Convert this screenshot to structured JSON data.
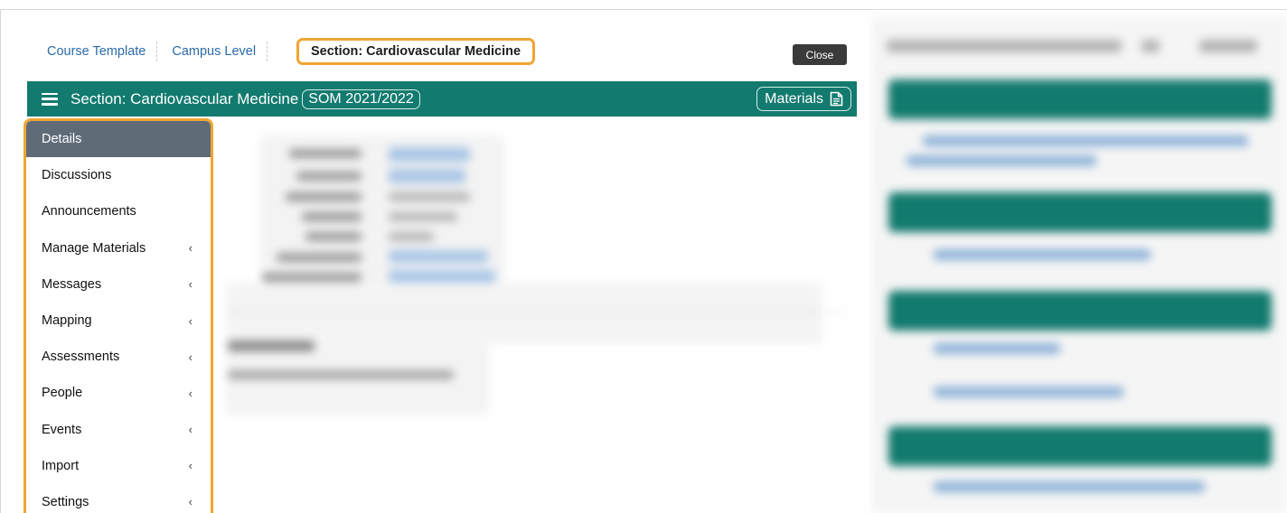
{
  "breadcrumb": {
    "items": [
      "Course Template",
      "Campus Level"
    ],
    "current": "Section: Cardiovascular Medicine"
  },
  "close_label": "Close",
  "section_bar": {
    "title": "Section: Cardiovascular Medicine",
    "term": "SOM 2021/2022",
    "materials_label": "Materials"
  },
  "nav": {
    "items": [
      {
        "label": "Details",
        "active": true,
        "has_submenu": false
      },
      {
        "label": "Discussions",
        "has_submenu": false
      },
      {
        "label": "Announcements",
        "has_submenu": false
      },
      {
        "label": "Manage Materials",
        "has_submenu": true
      },
      {
        "label": "Messages",
        "has_submenu": true
      },
      {
        "label": "Mapping",
        "has_submenu": true
      },
      {
        "label": "Assessments",
        "has_submenu": true
      },
      {
        "label": "People",
        "has_submenu": true
      },
      {
        "label": "Events",
        "has_submenu": true
      },
      {
        "label": "Import",
        "has_submenu": true
      },
      {
        "label": "Settings",
        "has_submenu": true
      }
    ],
    "chevron": "‹"
  },
  "colors": {
    "brand_teal": "#127a6e",
    "highlight_orange": "#f0a533",
    "active_nav": "#5f6c78",
    "link_blue": "#2a6aa8"
  },
  "icons": [
    "hamburger-icon",
    "document-icon",
    "chevron-left-icon"
  ]
}
